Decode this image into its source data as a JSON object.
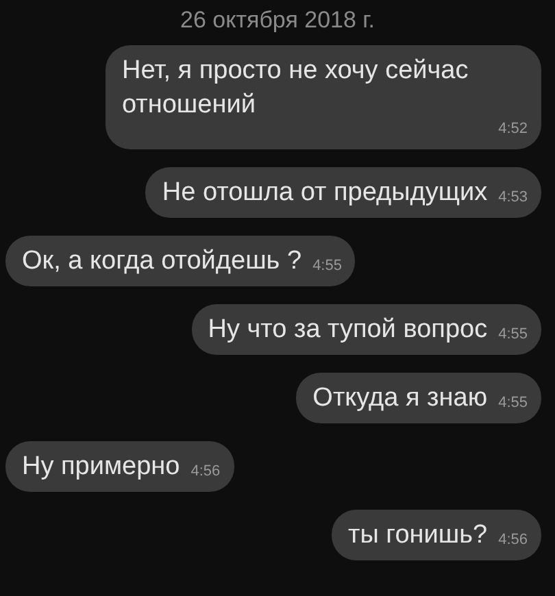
{
  "date": "26 октября 2018 г.",
  "messages": [
    {
      "text": "Нет, я просто не хочу сейчас отношений",
      "time": "4:52",
      "kind": "outgoing"
    },
    {
      "text": "Не отошла от предыдущих",
      "time": "4:53",
      "kind": "outgoing"
    },
    {
      "text": "Ок, а когда отойдешь ?",
      "time": "4:55",
      "kind": "incoming"
    },
    {
      "text": "Ну что за тупой вопрос",
      "time": "4:55",
      "kind": "outgoing"
    },
    {
      "text": "Откуда я знаю",
      "time": "4:55",
      "kind": "outgoing"
    },
    {
      "text": "Ну примерно",
      "time": "4:56",
      "kind": "incoming"
    },
    {
      "text": "ты гонишь?",
      "time": "4:56",
      "kind": "outgoing"
    }
  ]
}
